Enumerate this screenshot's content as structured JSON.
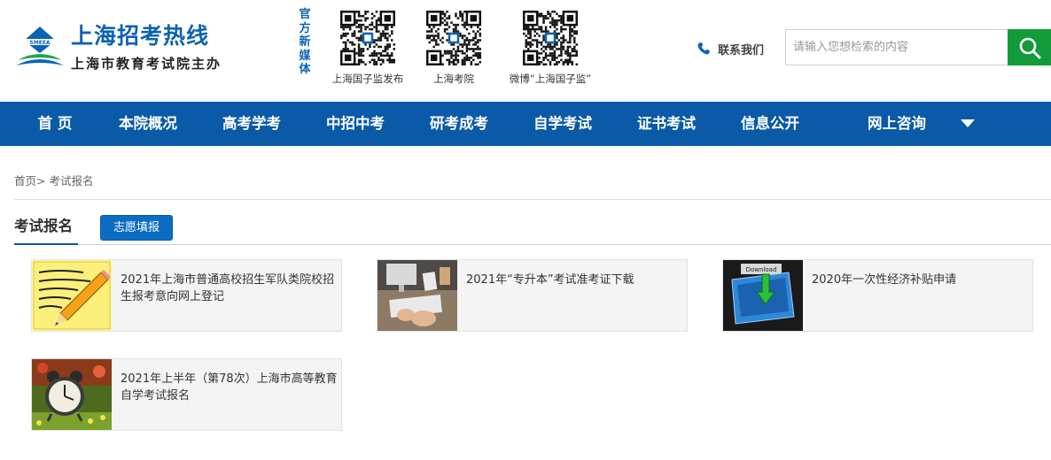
{
  "brand": {
    "title": "上海招考热线",
    "subtitle": "上海市教育考试院主办",
    "mark_text": "SMEEA"
  },
  "new_media": {
    "label": "官方新媒体",
    "codes": [
      {
        "label": "上海国子监发布"
      },
      {
        "label": "上海考院"
      },
      {
        "label": "微博“上海国子监”"
      }
    ]
  },
  "contact": {
    "label": "联系我们",
    "icon": "phone-icon"
  },
  "search": {
    "placeholder": "请输入您想检索的内容",
    "value": "",
    "icon": "search-icon"
  },
  "nav": {
    "items": [
      {
        "label": "首 页"
      },
      {
        "label": "本院概况"
      },
      {
        "label": "高考学考"
      },
      {
        "label": "中招中考"
      },
      {
        "label": "研考成考"
      },
      {
        "label": "自学考试"
      },
      {
        "label": "证书考试"
      },
      {
        "label": "信息公开"
      },
      {
        "label": "网上咨询"
      }
    ],
    "more_icon": "caret-down-icon"
  },
  "breadcrumb": {
    "home": "首页",
    "separator": ">",
    "current": "考试报名"
  },
  "section": {
    "title": "考试报名",
    "tab": "志愿填报"
  },
  "cards": [
    {
      "text": "2021年上海市普通高校招生军队类院校招生报考意向网上登记",
      "thumb": "pencil-notepad-image"
    },
    {
      "text": "2021年“专升本”考试准考证下载",
      "thumb": "desk-keyboard-image"
    },
    {
      "text": "2020年一次性经济补贴申请",
      "thumb": "download-folder-image"
    },
    {
      "text": "2021年上半年（第78次）上海市高等教育自学考试报名",
      "thumb": "alarm-clock-image"
    }
  ],
  "colors": {
    "brand_blue": "#0b63b4",
    "nav_blue": "#0a5aa7",
    "search_green": "#129b3b",
    "tab_blue": "#0b6cc4"
  }
}
